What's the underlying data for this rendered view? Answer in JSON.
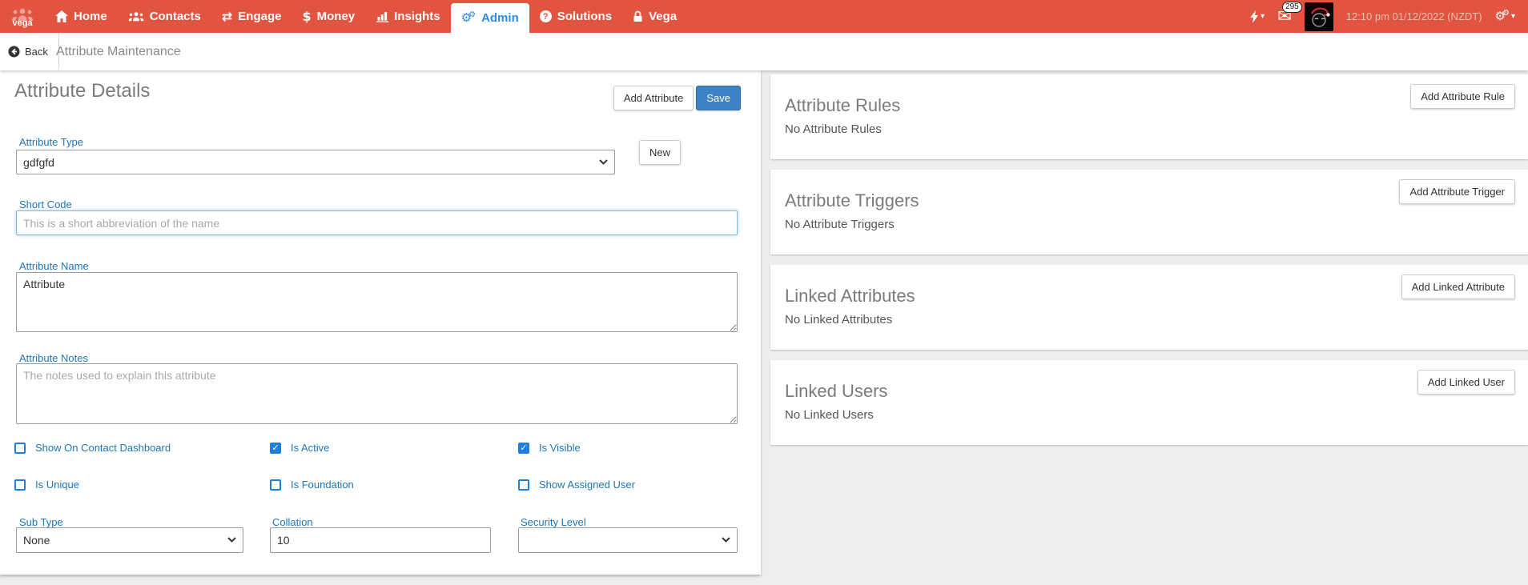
{
  "nav": {
    "brand": "vega",
    "items": [
      {
        "label": "Home"
      },
      {
        "label": "Contacts"
      },
      {
        "label": "Engage"
      },
      {
        "label": "Money"
      },
      {
        "label": "Insights"
      },
      {
        "label": "Admin",
        "active": true
      },
      {
        "label": "Solutions"
      },
      {
        "label": "Vega"
      }
    ],
    "icons": {
      "engage_glyph": "⇄",
      "money_glyph": "$",
      "admin_glyph": "⚙",
      "solutions_glyph": "?",
      "envelope_glyph": "✉",
      "caret_glyph": "▾",
      "settings_glyph": "⚙"
    },
    "notification_count": "295",
    "datetime": "12:10 pm 01/12/2022 (NZDT)"
  },
  "breadcrumb": {
    "back_label": "Back",
    "title": "Attribute Maintenance"
  },
  "details": {
    "title": "Attribute Details",
    "add_attribute_label": "Add Attribute",
    "save_label": "Save",
    "new_label": "New",
    "fields": {
      "attribute_type": {
        "label": "Attribute Type",
        "value": "gdfgfd"
      },
      "short_code": {
        "label": "Short Code",
        "value": "",
        "placeholder": "This is a short abbreviation of the name"
      },
      "attribute_name": {
        "label": "Attribute Name",
        "value": "Attribute"
      },
      "attribute_notes": {
        "label": "Attribute Notes",
        "value": "",
        "placeholder": "The notes used to explain this attribute"
      },
      "sub_type": {
        "label": "Sub Type",
        "value": "None"
      },
      "collation": {
        "label": "Collation",
        "value": "10"
      },
      "security_level": {
        "label": "Security Level",
        "value": ""
      }
    },
    "checkboxes": [
      {
        "label": "Show On Contact Dashboard",
        "checked": false
      },
      {
        "label": "Is Active",
        "checked": true
      },
      {
        "label": "Is Visible",
        "checked": true
      },
      {
        "label": "Is Unique",
        "checked": false
      },
      {
        "label": "Is Foundation",
        "checked": false
      },
      {
        "label": "Show Assigned User",
        "checked": false
      }
    ]
  },
  "panels": [
    {
      "title": "Attribute Rules",
      "empty": "No Attribute Rules",
      "button": "Add Attribute Rule"
    },
    {
      "title": "Attribute Triggers",
      "empty": "No Attribute Triggers",
      "button": "Add Attribute Trigger"
    },
    {
      "title": "Linked Attributes",
      "empty": "No Linked Attributes",
      "button": "Add Linked Attribute"
    },
    {
      "title": "Linked Users",
      "empty": "No Linked Users",
      "button": "Add Linked User"
    }
  ],
  "colors": {
    "nav_red": "#e25440",
    "active_blue": "#2f8be6",
    "label_blue": "#1d75ba",
    "checkbox_blue": "#1d7fe0",
    "save_blue": "#3d82c4",
    "heading_gray": "#7b7b7b",
    "timestamp_pink": "#f4bcb1"
  }
}
